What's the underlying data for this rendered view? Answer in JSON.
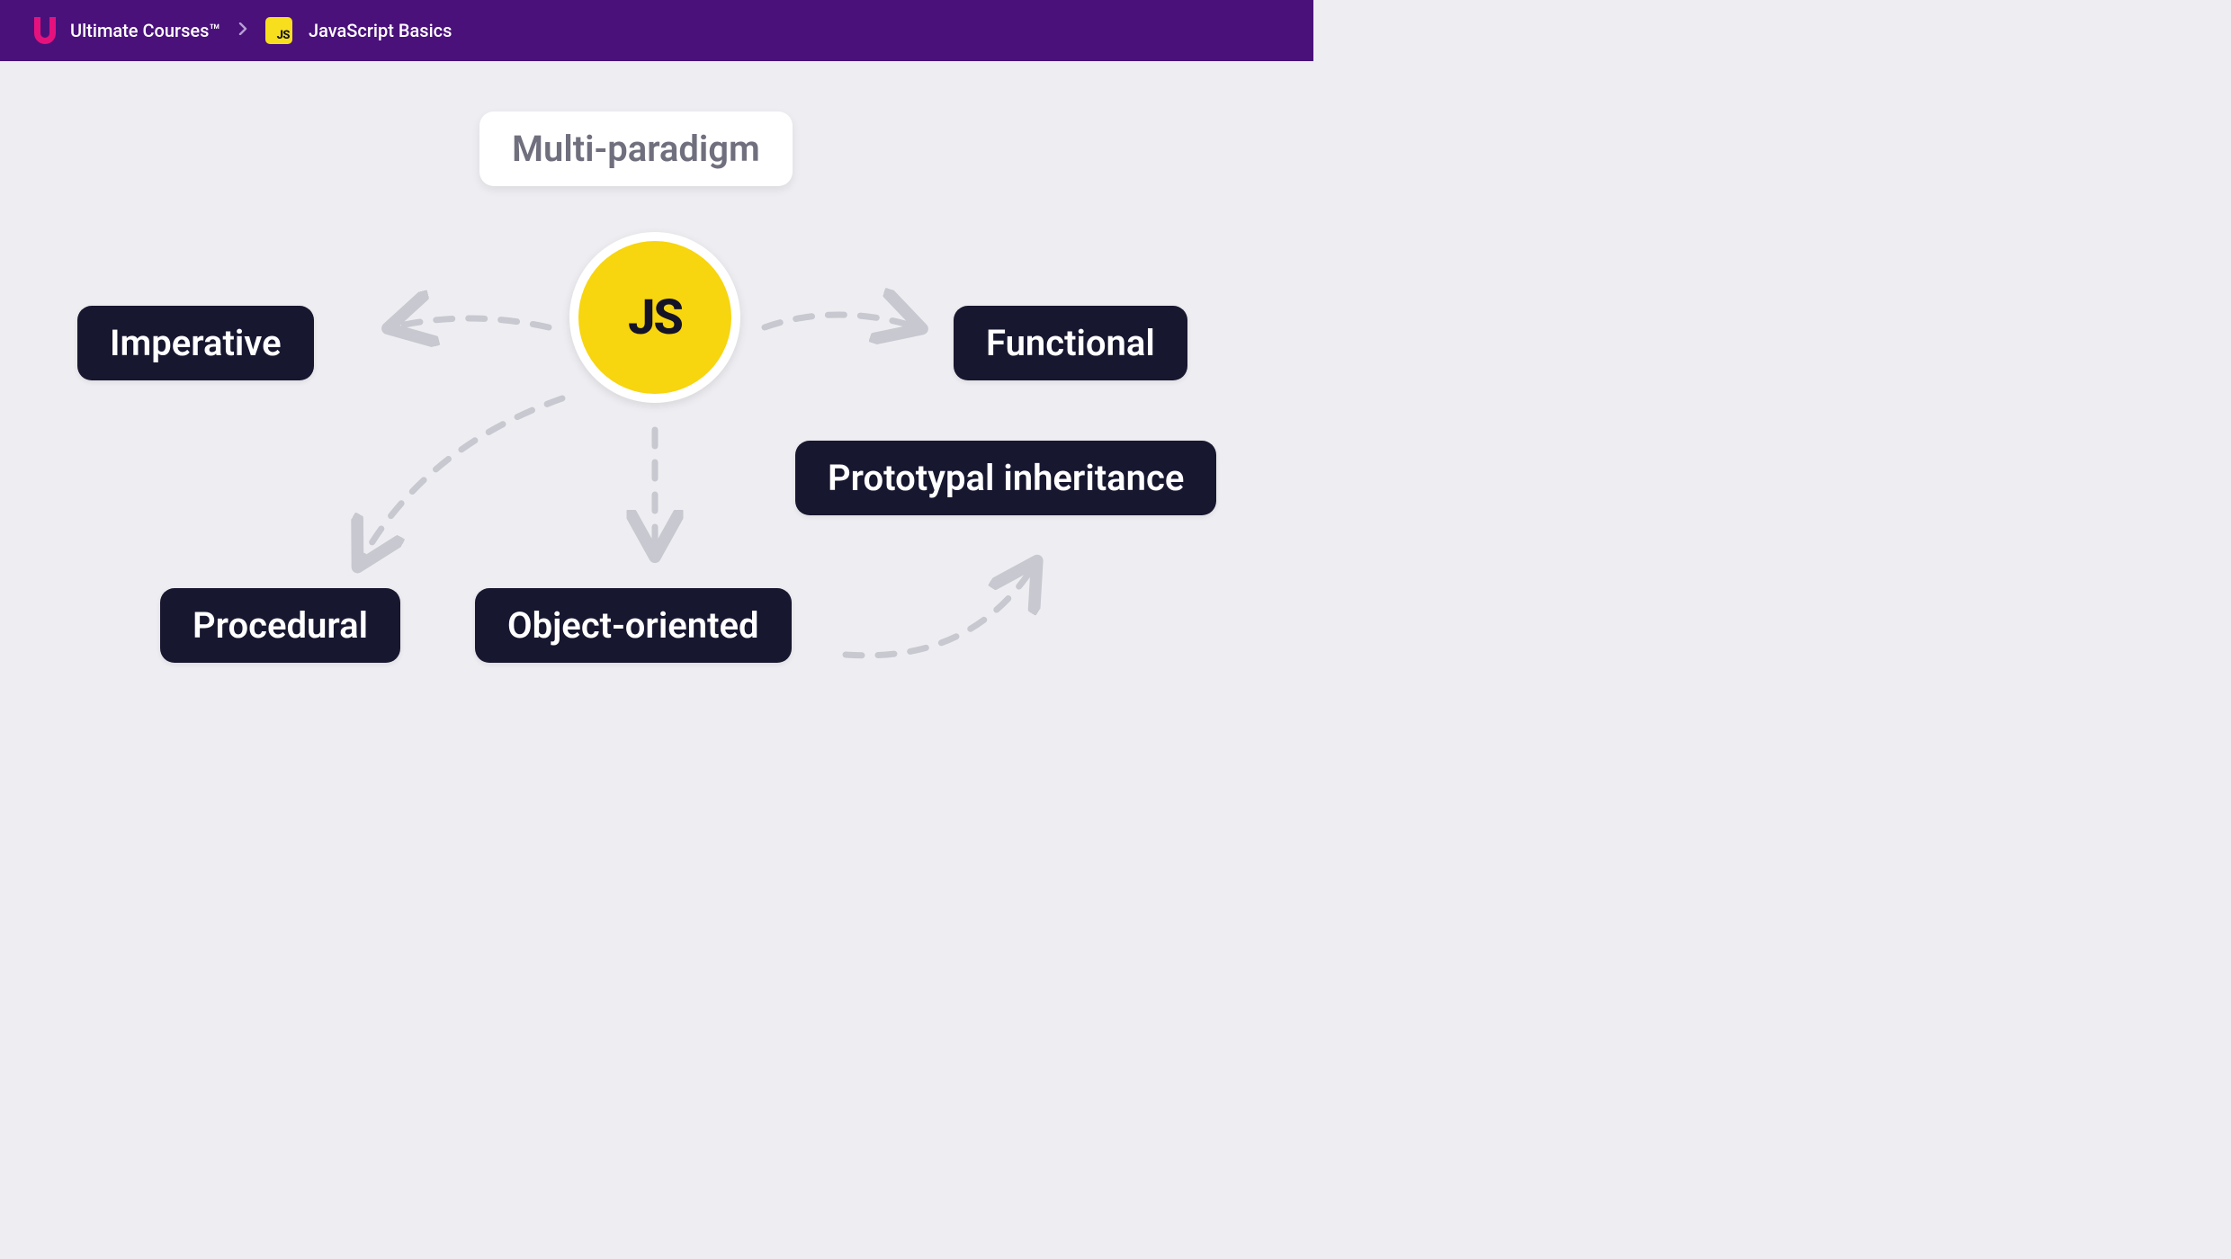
{
  "header": {
    "brand": "Ultimate Courses™",
    "course_title": "JavaScript Basics",
    "badge_label": "JS"
  },
  "diagram": {
    "center_label": "JS",
    "nodes": {
      "top": {
        "label": "Multi-paradigm",
        "style": "white"
      },
      "left": {
        "label": "Imperative",
        "style": "dark"
      },
      "right": {
        "label": "Functional",
        "style": "dark"
      },
      "bottom_left": {
        "label": "Procedural",
        "style": "dark"
      },
      "bottom_mid": {
        "label": "Object-oriented",
        "style": "dark"
      },
      "right_mid": {
        "label": "Prototypal inheritance",
        "style": "dark"
      }
    }
  },
  "colors": {
    "header_bg": "#4a117a",
    "page_bg": "#eeeef2",
    "pill_dark": "#181730",
    "js_yellow": "#f7d50f",
    "arrow": "#c7c8d0",
    "logo_pink": "#e5127e"
  }
}
